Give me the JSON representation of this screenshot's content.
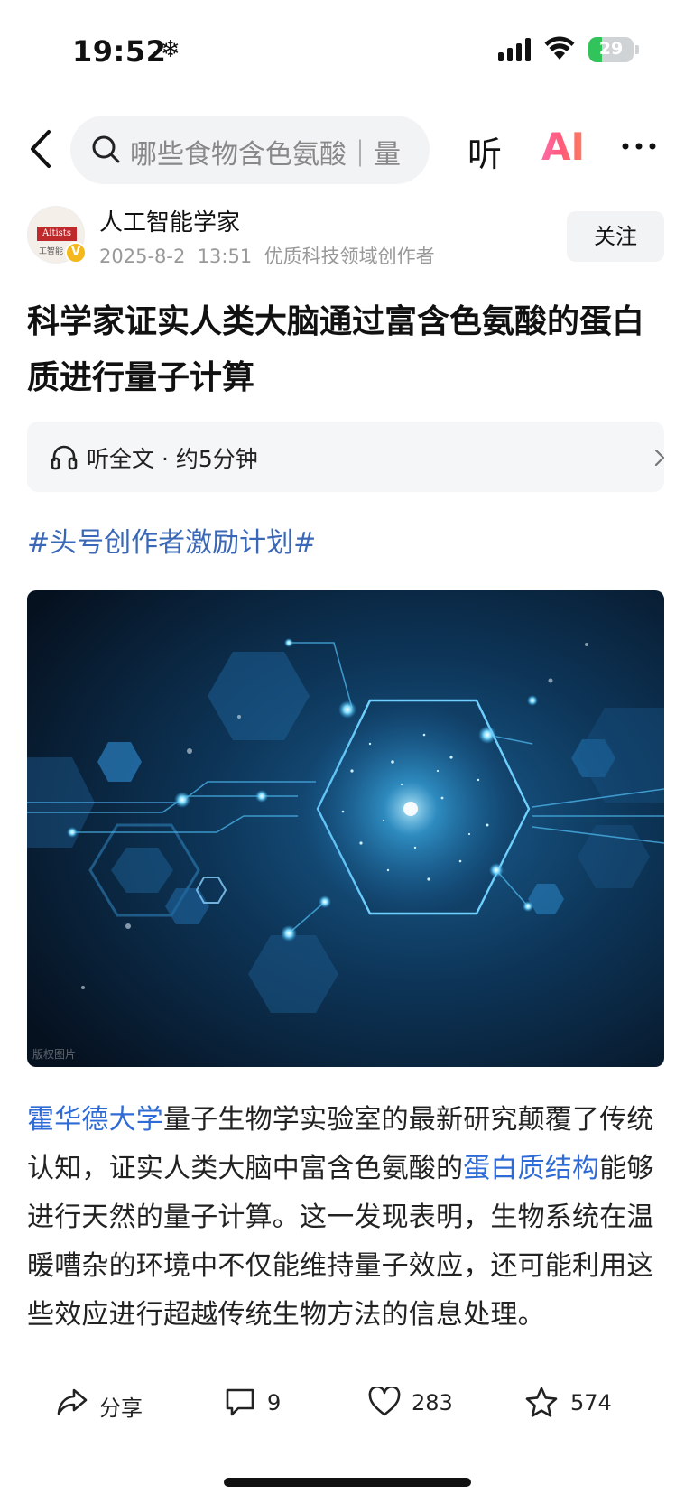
{
  "status_bar": {
    "time": "19:52",
    "battery": "29",
    "battery_level": 0.29
  },
  "top_nav": {
    "search_placeholder": "哪些食物含色氨酸｜量",
    "listen_label": "听",
    "ai_label": "AI"
  },
  "author": {
    "name": "人工智能学家",
    "date": "2025-8-2",
    "time": "13:51",
    "badge": "优质科技领域创作者",
    "follow_label": "关注",
    "avatar_logo_text": "Aitists",
    "avatar_sub_text": "工智能"
  },
  "article": {
    "title": "科学家证实人类大脑通过富含色氨酸的蛋白质进行量子计算",
    "listen_bar": "听全文 · 约5分钟",
    "hashtag": "#头号创作者激励计划#",
    "image_credit": "版权图片",
    "body": {
      "link1": "霍华德大学",
      "text1": "量子生物学实验室的最新研究颠覆了传统认知，证实人类大脑中富含色氨酸的",
      "link2": "蛋白质结构",
      "text2": "能够进行天然的量子计算。这一发现表明，生物系统在温暖嘈杂的环境中不仅能维持量子效应，还可能利用这些效应进行超越传统生物方法的信息处理。"
    }
  },
  "actions": {
    "share_label": "分享",
    "comments": "9",
    "likes": "283",
    "favorites": "574"
  },
  "colors": {
    "link": "#2f6bd6",
    "hashtag": "#3a68b7",
    "battery": "#30c45a",
    "ai_gradient_start": "#ff6aa8",
    "ai_gradient_end": "#ff7a5c"
  },
  "icons": [
    "back-arrow-icon",
    "search-icon",
    "more-icon",
    "headphones-icon",
    "chevron-right-icon",
    "share-icon",
    "comment-icon",
    "heart-icon",
    "star-icon",
    "cellular-signal-icon",
    "wifi-icon",
    "battery-icon",
    "snowflake-icon",
    "verified-badge-icon"
  ]
}
